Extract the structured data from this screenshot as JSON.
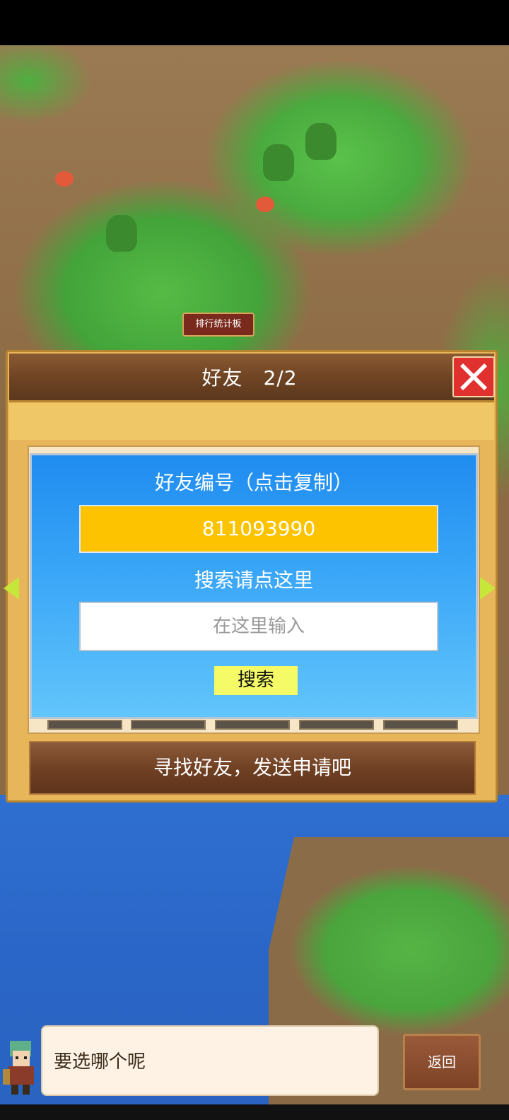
{
  "map": {
    "sign_label": "排行统计板"
  },
  "dialog": {
    "title": "好友　2/2",
    "close_icon": "close-icon",
    "id_heading": "好友编号（点击复制）",
    "friend_id": "811093990",
    "search_heading": "搜索请点这里",
    "search_placeholder": "在这里输入",
    "search_button": "搜索",
    "send_request": "寻找好友，发送申请吧"
  },
  "footer": {
    "message": "要选哪个呢",
    "back_button": "返回"
  },
  "colors": {
    "panel_blue": "#2196f3",
    "id_box_yellow": "#fdc300",
    "search_button": "#f4fb66",
    "close_red": "#e0312e",
    "dialog_wood": "#e7b65a"
  }
}
